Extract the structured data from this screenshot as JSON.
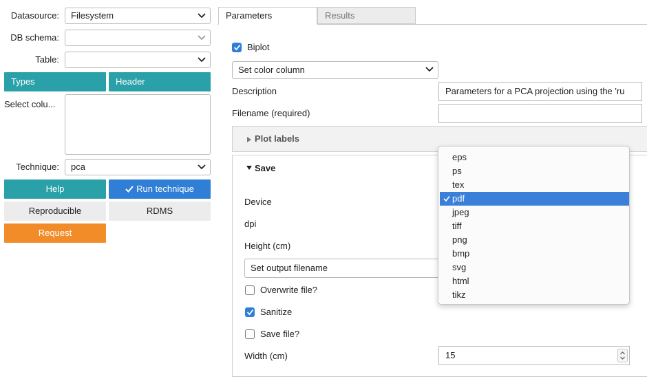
{
  "sidebar": {
    "datasource_label": "Datasource:",
    "datasource_value": "Filesystem",
    "dbschema_label": "DB schema:",
    "dbschema_value": "",
    "table_label": "Table:",
    "table_value": "",
    "types_button": "Types",
    "header_button": "Header",
    "select_columns_label": "Select colu...",
    "technique_label": "Technique:",
    "technique_value": "pca",
    "help_button": "Help",
    "run_button": "Run technique",
    "reproducible_button": "Reproducible",
    "rdms_button": "RDMS",
    "request_button": "Request"
  },
  "tabs": [
    {
      "label": "Parameters",
      "active": true
    },
    {
      "label": "Results",
      "active": false
    }
  ],
  "params": {
    "biplot_label": "Biplot",
    "biplot_checked": true,
    "color_column_value": "Set color column",
    "description_label": "Description",
    "description_value": "Parameters for a PCA projection using the 'ru",
    "filename_label": "Filename (required)",
    "filename_value": "",
    "plot_labels_section": "Plot labels",
    "save_section": "Save",
    "device_label": "Device",
    "dpi_label": "dpi",
    "height_label": "Height (cm)",
    "output_filename_value": "Set output filename",
    "overwrite_label": "Overwrite file?",
    "overwrite_checked": false,
    "sanitize_label": "Sanitize",
    "sanitize_checked": true,
    "savefile_label": "Save file?",
    "savefile_checked": false,
    "width_label": "Width (cm)",
    "width_value": "15"
  },
  "device_dropdown": {
    "options": [
      "eps",
      "ps",
      "tex",
      "pdf",
      "jpeg",
      "tiff",
      "png",
      "bmp",
      "svg",
      "html",
      "tikz"
    ],
    "selected": "pdf"
  },
  "colors": {
    "teal": "#2aa0a8",
    "blue": "#2f7fd6",
    "orange": "#f28c28",
    "selection": "#3a80d8"
  }
}
